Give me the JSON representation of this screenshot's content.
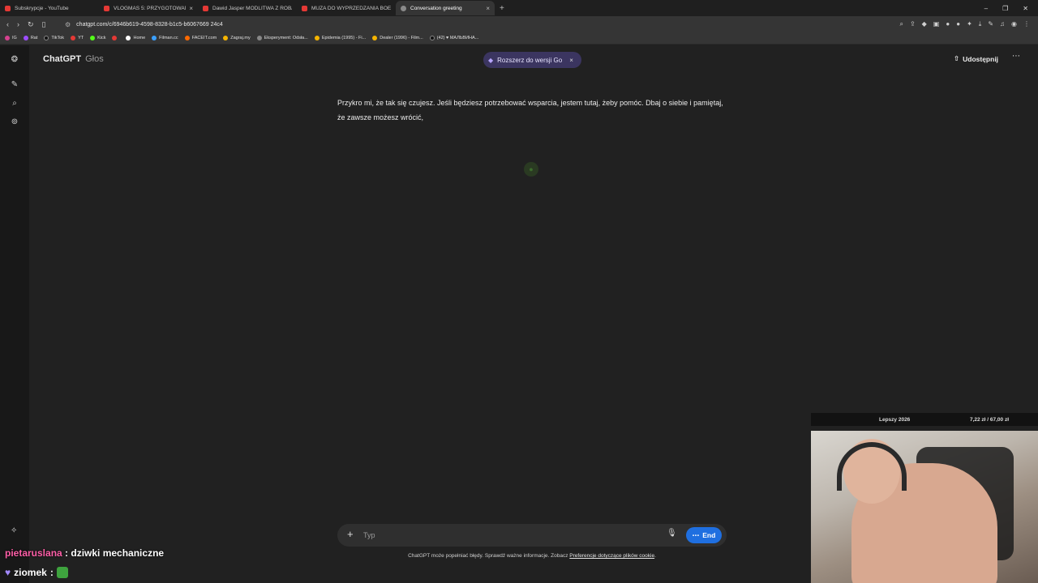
{
  "tabs": [
    {
      "label": "Subskrypcje - YouTube",
      "active": false
    },
    {
      "label": "VLOGMAS 5: PRZYGOTOWANIA",
      "active": false
    },
    {
      "label": "Dawid Jasper MODLITWA Z ROBALII",
      "active": false
    },
    {
      "label": "MUZA DO WYPRZEDZANIA BOEINGA",
      "active": false
    },
    {
      "label": "Conversation greeting",
      "active": true
    }
  ],
  "address": {
    "url": "chatgpt.com/c/6946b619-4598-8328-b1c5-b6067669 24c4"
  },
  "bookmarks": [
    "IG",
    "Rat",
    "TikTok",
    "YT",
    "Kick",
    "",
    "Home",
    "Filman.cc",
    "FACEIT.com",
    "Zagraj.my",
    "Eksperyment: Odsła...",
    "Epidemia (1995) - Fi...",
    "Dealer (1996) - Film...",
    "(42) ♥ МАЛЬВИНА..."
  ],
  "header": {
    "brand": "ChatGPT",
    "mode": "Głos",
    "upgrade_label": "Rozszerz do wersji Go",
    "share_label": "Udostępnij"
  },
  "message": {
    "text": "Przykro mi, że tak się czujesz. Jeśli będziesz potrzebować wsparcia, jestem tutaj, żeby pomóc. Dbaj o siebie i pamiętaj, że zawsze możesz wrócić,"
  },
  "composer": {
    "placeholder": "Typ",
    "end_label": "End"
  },
  "disclaimer": {
    "text": "ChatGPT może popełniać błędy. Sprawdź ważne informacje. Zobacz ",
    "link": "Preferencje dotyczące plików cookie",
    "suffix": "."
  },
  "overlay": {
    "chat": [
      {
        "user": "pietaruslana",
        "text": " : dziwki mechaniczne"
      },
      {
        "user": "ziomek",
        "text": " :"
      }
    ],
    "donation_title": "Lepszy 2026",
    "donation_amount": "7,22 zł / 67,00 zł"
  },
  "colors": {
    "background": "#212121",
    "accent_end": "#1f6fe0",
    "upgrade_pill": "#3b3560",
    "chat_user": "#ff5fa8"
  }
}
